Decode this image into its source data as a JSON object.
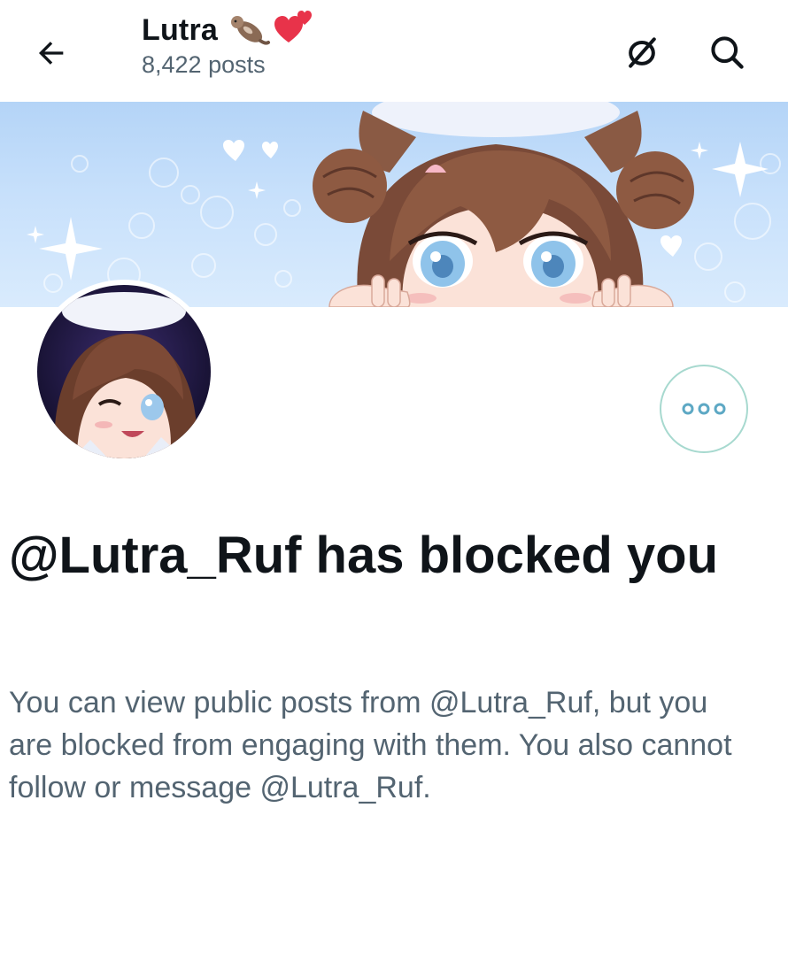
{
  "header": {
    "title": "Lutra",
    "post_count": "8,422 posts",
    "back_icon": "arrow-left-icon",
    "actions": [
      {
        "icon": "unsubscribe-bell-icon"
      },
      {
        "icon": "search-icon"
      }
    ]
  },
  "profile": {
    "more_icon": "more-horizontal-icon",
    "accent_color": "#a7d9cf"
  },
  "blocked": {
    "title": "@Lutra_Ruf has blocked you",
    "description": "You can view public posts from @Lutra_Ruf, but you are blocked from engaging with them. You also cannot follow or message @Lutra_Ruf."
  }
}
